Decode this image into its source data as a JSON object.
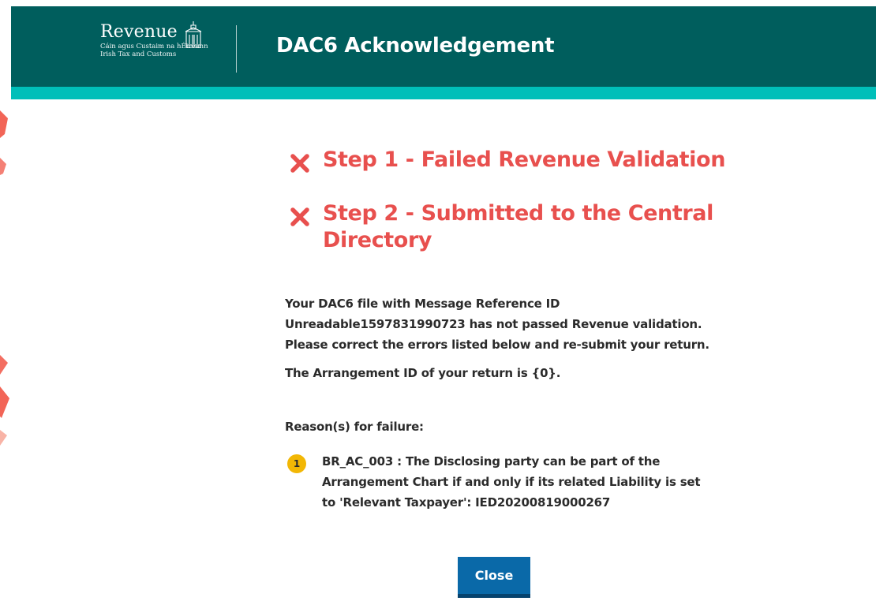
{
  "header": {
    "logo": {
      "name": "Revenue",
      "subtitle_line1": "Cáin agus Custaim na hÉireann",
      "subtitle_line2": "Irish Tax and Customs"
    },
    "title": "DAC6 Acknowledgement"
  },
  "steps": [
    {
      "label": "Step 1 - Failed Revenue Validation",
      "status": "failed",
      "icon": "cross-icon"
    },
    {
      "label": "Step 2 - Submitted to the Central Directory",
      "status": "failed",
      "icon": "cross-icon"
    }
  ],
  "message": {
    "line1": "Your DAC6 file with Message Reference ID",
    "line2": "Unreadable1597831990723 has not passed Revenue validation.",
    "line3": "Please correct the errors listed below and re-submit your return.",
    "arrangement": "The Arrangement ID of your return is {0}."
  },
  "reasons": {
    "heading": "Reason(s) for failure:",
    "items": [
      {
        "number": "1",
        "text": "BR_AC_003 : The Disclosing party can be part of the Arrangement Chart if and only if its related Liability is set to 'Relevant Taxpayer': IED20200819000267"
      }
    ]
  },
  "actions": {
    "close_label": "Close"
  },
  "colors": {
    "header_bg": "#005e5d",
    "header_stripe": "#00bfb9",
    "error_red": "#e8504e",
    "badge_yellow": "#f2b705",
    "button_blue": "#0a69a8"
  }
}
